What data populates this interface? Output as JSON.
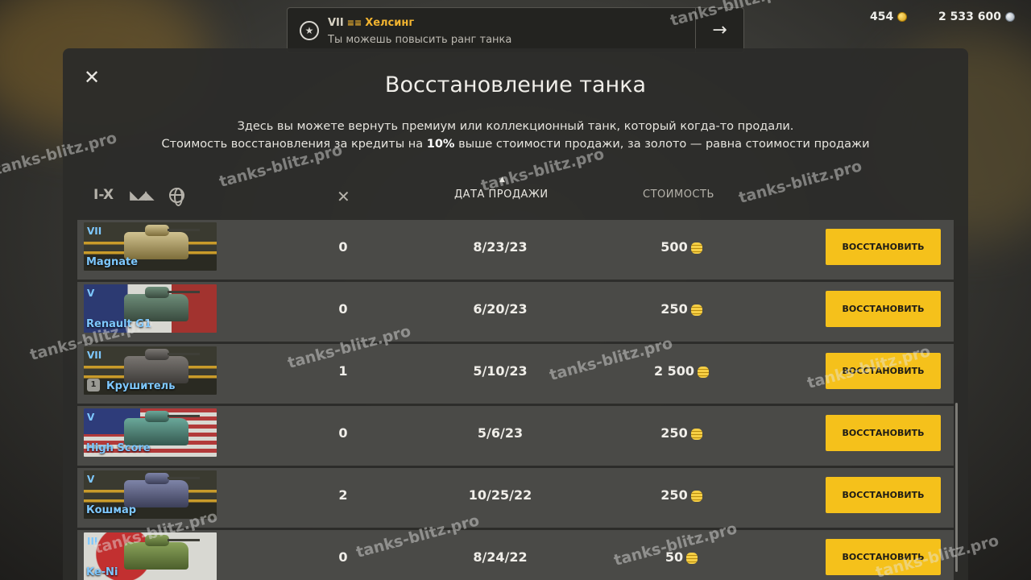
{
  "top_bar": {
    "notification": {
      "tier": "VII",
      "tank_name": "Хелсинг",
      "message": "Ты можешь повысить ранг танка"
    },
    "gold": "454",
    "credits": "2 533 600"
  },
  "dialog": {
    "title": "Восстановление танка",
    "desc_line1": "Здесь вы можете вернуть премиум или коллекционный танк, который когда-то продали.",
    "desc_line2_pre": "Стоимость восстановления за кредиты на ",
    "desc_line2_bold": "10%",
    "desc_line2_post": " выше стоимости продажи, за золото — равна стоимости продажи"
  },
  "filters": {
    "tier": "I-X"
  },
  "columns": {
    "date": "ДАТА ПРОДАЖИ",
    "cost": "СТОИМОСТЬ"
  },
  "rows": [
    {
      "tier": "VII",
      "name": "Magnate",
      "battles": "0",
      "date": "8/23/23",
      "cost": "500",
      "button": "ВОССТАНОВИТЬ"
    },
    {
      "tier": "V",
      "name": "Renault G1",
      "battles": "0",
      "date": "6/20/23",
      "cost": "250",
      "button": "ВОССТАНОВИТЬ"
    },
    {
      "tier": "VII",
      "name": "Крушитель",
      "mastery": "1",
      "battles": "1",
      "date": "5/10/23",
      "cost": "2 500",
      "button": "ВОССТАНОВИТЬ"
    },
    {
      "tier": "V",
      "name": "High Score",
      "battles": "0",
      "date": "5/6/23",
      "cost": "250",
      "button": "ВОССТАНОВИТЬ"
    },
    {
      "tier": "V",
      "name": "Кошмар",
      "battles": "2",
      "date": "10/25/22",
      "cost": "250",
      "button": "ВОССТАНОВИТЬ"
    },
    {
      "tier": "III",
      "name": "Ke-Ni",
      "battles": "0",
      "date": "8/24/22",
      "cost": "50",
      "button": "ВОССТАНОВИТЬ"
    }
  ],
  "watermark": "tanks-blitz.pro",
  "colors": {
    "accent_button": "#f5c11b",
    "tank_name": "#7ec8ff",
    "gold": "#f2b430"
  }
}
